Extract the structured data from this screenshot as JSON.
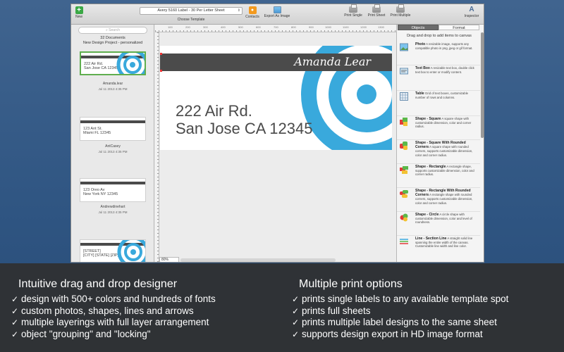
{
  "toolbar": {
    "new_label": "New",
    "template_value": "Avery 5160 Label - 30 Per Letter Sheet",
    "template_caption": "Choose Template",
    "contacts_label": "Contacts",
    "export_label": "Export As Image",
    "print_single_label": "Print Single",
    "print_sheet_label": "Print Sheet",
    "print_multiple_label": "Print Multiple",
    "inspector_label": "Inspector",
    "inspector_glyph": "A"
  },
  "sidebar": {
    "search_placeholder": "Search",
    "doc_count": "32 Documents",
    "project_name": "New Design Project - personalized",
    "thumbs": [
      {
        "line1": "222 Air Rd.",
        "line2": "San Jose CA 12345",
        "name": "Amanda.lear",
        "date": "Jul 11 2013 4:35 PM",
        "selected": true
      },
      {
        "line1": "123 Ant St.",
        "line2": "Miami FL 12345",
        "name": "AntCasey",
        "date": "Jul 11 2013 4:35 PM",
        "selected": false
      },
      {
        "line1": "123 Oreo Av",
        "line2": "New York NY 12345",
        "name": "Andrewdinehart",
        "date": "Jul 11 2013 4:35 PM",
        "selected": false
      },
      {
        "line1": "[STREET]",
        "line2": "[CITY] [STATE] [ZIP]",
        "name": "",
        "date": "",
        "selected": false
      }
    ]
  },
  "canvas": {
    "name": "Amanda Lear",
    "address_line1": "222 Air Rd.",
    "address_line2": "San Jose CA 12345",
    "zoom": "80%",
    "ruler_numbers": [
      "100",
      "200",
      "300",
      "400",
      "500",
      "600",
      "700",
      "800",
      "900",
      "1000",
      "1100",
      "1200",
      "1300"
    ],
    "accent_color": "#39a9dc"
  },
  "panel": {
    "tab_objects": "Objects",
    "tab_format": "Format",
    "hint": "Drag and drop to add items to canvas",
    "objects": [
      {
        "title": "Photo",
        "desc": "A resizable image, supports any compatible photo in png, jpeg or gif format.",
        "icon": "photo-icon"
      },
      {
        "title": "Text Box",
        "desc": "A resizable text box, double click text box to enter or modify content.",
        "icon": "text-box-icon"
      },
      {
        "title": "Table",
        "desc": "Grid of text boxes, customizable number of rows and columns.",
        "icon": "table-icon"
      },
      {
        "title": "Shape - Square",
        "desc": "A square shape with customizable dimension, color and corner radius.",
        "icon": "shape-square-icon"
      },
      {
        "title": "Shape - Square With Rounded Corners",
        "desc": "A square shape with rounded corners, supports customizable dimension, color and corner radius.",
        "icon": "shape-rounded-square-icon"
      },
      {
        "title": "Shape - Rectangle",
        "desc": "A rectangle shape, supports customizable dimension, color and corner radius.",
        "icon": "shape-rectangle-icon"
      },
      {
        "title": "Shape - Rectangle With Rounded Corners",
        "desc": "A rectangle shape with rounded corners, supports customizable dimension, color and corner radius.",
        "icon": "shape-rounded-rectangle-icon"
      },
      {
        "title": "Shape - Circle",
        "desc": "A circle shape with customizable dimension, color and level of roundness.",
        "icon": "shape-circle-icon"
      },
      {
        "title": "Line - Section Line",
        "desc": "A straight solid line spanning the entire width of the canvas. Customizable line width and line color.",
        "icon": "section-line-icon"
      }
    ]
  },
  "features": {
    "left_title": "Intuitive drag and drop designer",
    "left": [
      "design with 500+ colors and hundreds of fonts",
      "custom photos, shapes, lines and arrows",
      "multiple layerings with full layer arrangement",
      "object \"grouping\" and \"locking\""
    ],
    "right_title": "Multiple print options",
    "right": [
      "prints single labels to any available template spot",
      "prints full sheets",
      "prints multiple label designs to the same sheet",
      "supports design export in HD image format"
    ],
    "check": "✓"
  }
}
